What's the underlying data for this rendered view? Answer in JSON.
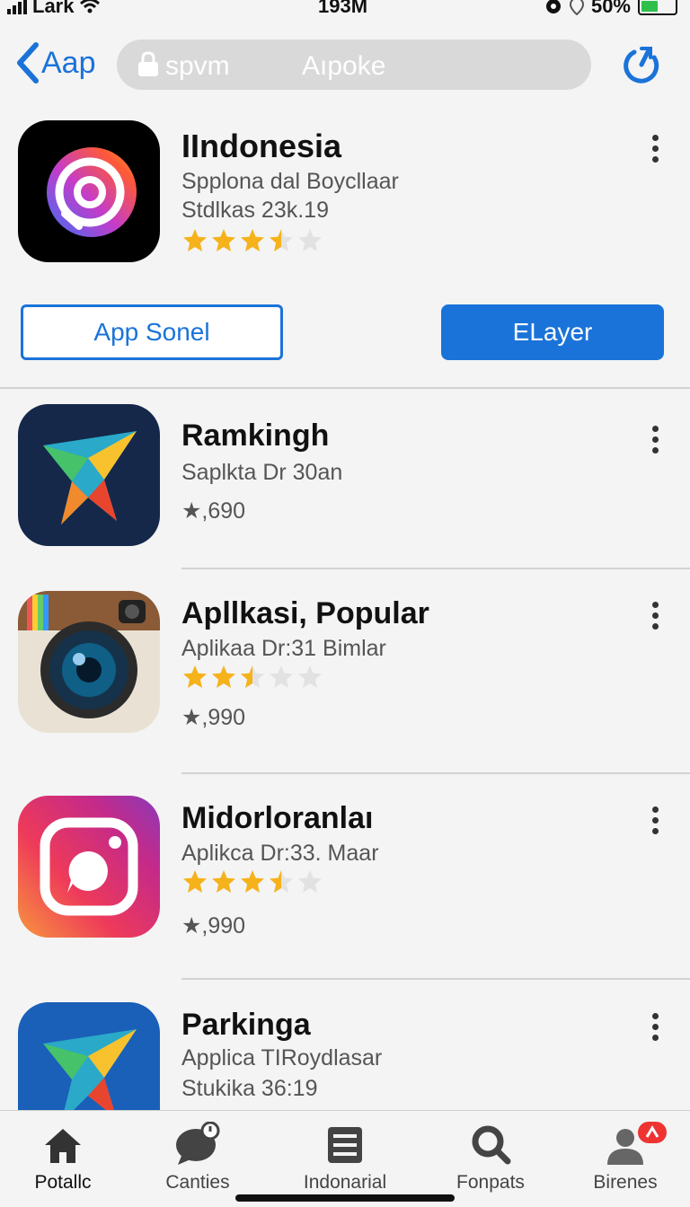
{
  "status_bar": {
    "carrier": "Lark",
    "time": "193M",
    "battery": "50%",
    "battery_level": 0.5
  },
  "nav": {
    "back_label": "Aap",
    "search_left": "spvm",
    "search_right": "Aıpoke"
  },
  "featured": {
    "title": "IIndonesia",
    "subtitle": "Spplona dal Boycllaar",
    "meta": "Stdlkas 23k.19",
    "rating": 3.5,
    "button_outline": "App Sonel",
    "button_solid": "ELayer"
  },
  "apps": [
    {
      "title": "Ramkingh",
      "subtitle": "Saplkta Dr 30an",
      "count": "★,690",
      "rating": null,
      "icon": "star-arrow-icon"
    },
    {
      "title": "Apllkasi, Popular",
      "subtitle": "Aplikaa Dr:31 Bimlar",
      "count": "★,990",
      "rating": 2.5,
      "icon": "camera-icon"
    },
    {
      "title": "Midorloranlaı",
      "subtitle": "Aplikca Dr:33. Maar",
      "count": "★,990",
      "rating": 3.5,
      "icon": "instagram-icon"
    },
    {
      "title": "Parkinga",
      "subtitle": "Applica TIRoydlasar",
      "count": "Stukika 36:19",
      "rating": null,
      "icon": "star-arrow-icon"
    }
  ],
  "tabs": [
    {
      "label": "Potallc",
      "icon": "home-icon"
    },
    {
      "label": "Canties",
      "icon": "chat-icon"
    },
    {
      "label": "Indonarial",
      "icon": "list-icon"
    },
    {
      "label": "Fonpats",
      "icon": "search-icon"
    },
    {
      "label": "Birenes",
      "icon": "person-icon"
    }
  ],
  "colors": {
    "accent": "#1a73d9",
    "star": "#f5b21b",
    "battery": "#2ec04a",
    "badge": "#e33333"
  }
}
